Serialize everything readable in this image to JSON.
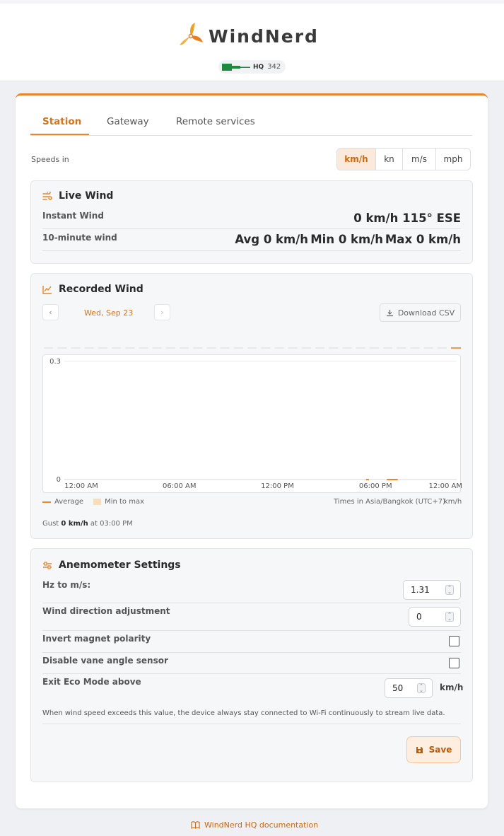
{
  "brand": {
    "name": "WindNerd",
    "model": "HQ",
    "device_number": "342"
  },
  "tabs": [
    {
      "label": "Station"
    },
    {
      "label": "Gateway"
    },
    {
      "label": "Remote services"
    }
  ],
  "units": {
    "label": "Speeds in",
    "options": [
      "km/h",
      "kn",
      "m/s",
      "mph"
    ],
    "selected": "km/h"
  },
  "live_wind": {
    "title": "Live Wind",
    "instant_label": "Instant Wind",
    "instant_value": "0 km/h 115° ESE",
    "ten_min_label": "10-minute wind",
    "avg": "Avg 0 km/h",
    "min": "Min 0 km/h",
    "max": "Max 0 km/h"
  },
  "recorded_wind": {
    "title": "Recorded Wind",
    "prev": "‹",
    "next": "›",
    "date": "Wed, Sep 23",
    "download_label": "Download CSV",
    "legend_average": "Average",
    "legend_range": "Min to max",
    "timezone": "Times in Asia/Bangkok (UTC+7)",
    "unit": "km/h",
    "gust_prefix": "Gust",
    "gust_value": "0 km/h",
    "gust_suffix": "at 03:00 PM"
  },
  "chart_data": {
    "type": "line",
    "x_tick_labels": [
      "12:00 AM",
      "06:00 AM",
      "12:00 PM",
      "06:00 PM",
      "12:00 AM"
    ],
    "y_tick_labels": [
      "0.3",
      "0"
    ],
    "ylim": [
      0,
      0.3
    ],
    "series": [
      {
        "name": "Average",
        "color": "#e8862a",
        "points": [
          [
            "15:00",
            0
          ],
          [
            "18:00",
            0
          ],
          [
            "18:40",
            0
          ]
        ]
      }
    ],
    "direction_strip_note": "dashes above chart",
    "legend_placement": "bottom-left"
  },
  "anemometer": {
    "title": "Anemometer Settings",
    "hz_label": "Hz to m/s:",
    "hz_value": "1.31",
    "dir_label": "Wind direction adjustment",
    "dir_value": "0",
    "invert_label": "Invert magnet polarity",
    "invert_checked": false,
    "vane_label": "Disable vane angle sensor",
    "vane_checked": false,
    "eco_label": "Exit Eco Mode above",
    "eco_value": "50",
    "eco_unit": "km/h",
    "eco_help": "When wind speed exceeds this value, the device always stay connected to Wi-Fi continuously to stream live data.",
    "save_label": "Save"
  },
  "footer": {
    "doc_link": "WindNerd HQ documentation"
  },
  "colors": {
    "accent": "#e8862a",
    "accent_light": "#fbeadb",
    "flag_green": "#1d8a3c"
  }
}
